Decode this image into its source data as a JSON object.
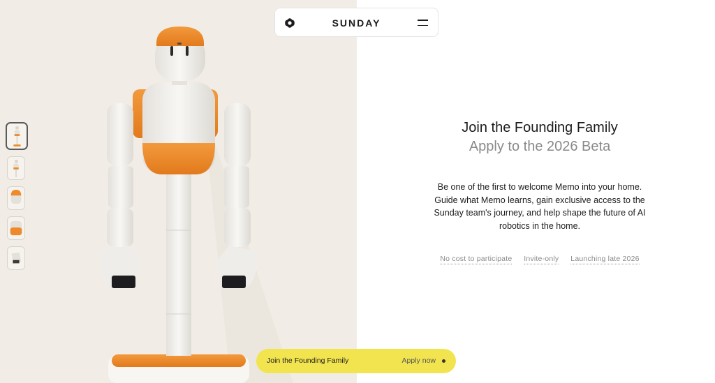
{
  "nav": {
    "brand": "SUNDAY",
    "logo_icon": "sunday-logo-icon",
    "menu_icon": "hamburger-menu-icon"
  },
  "hero": {
    "image_subject": "robot",
    "background": "#f1ede6",
    "accent": "#ee8a2b",
    "thumbnails": [
      {
        "id": "front",
        "active": true
      },
      {
        "id": "side",
        "active": false
      },
      {
        "id": "head",
        "active": false
      },
      {
        "id": "torso",
        "active": false
      },
      {
        "id": "hand",
        "active": false
      }
    ]
  },
  "main": {
    "headline": "Join the Founding Family",
    "subheadline": "Apply to the 2026 Beta",
    "body": "Be one of the first to welcome Memo into your home. Guide what Memo learns, gain exclusive access to the Sunday team's journey, and help shape the future of AI robotics in the home.",
    "tags": [
      "No cost to participate",
      "Invite-only",
      "Launching late 2026"
    ]
  },
  "cta": {
    "label": "Join the Founding Family",
    "action": "Apply now",
    "color": "#f2e44f"
  }
}
